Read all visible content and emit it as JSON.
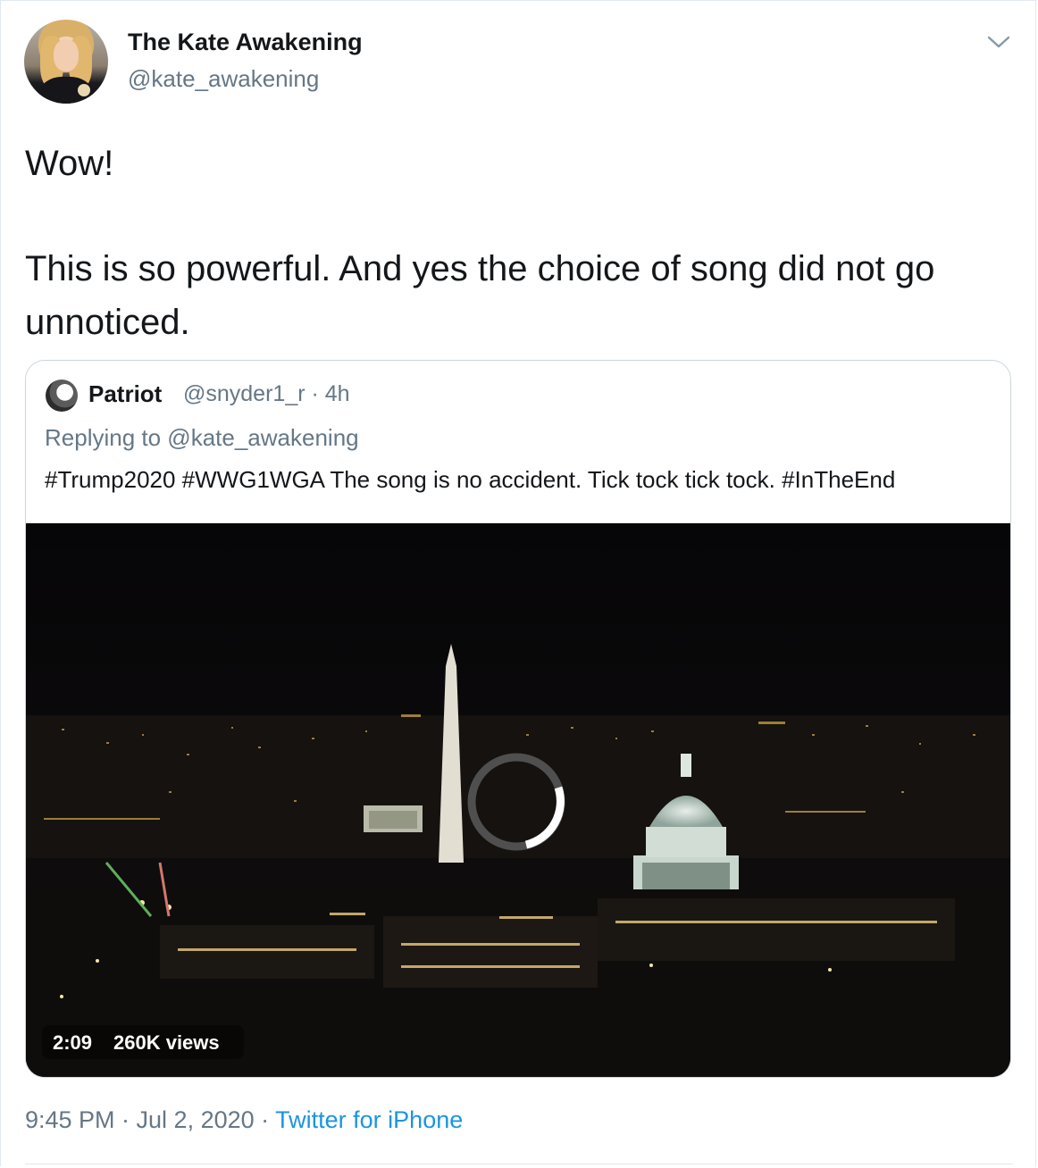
{
  "author": {
    "name": "The Kate Awakening",
    "handle": "@kate_awakening"
  },
  "tweet": {
    "line1": "Wow!",
    "line2": "This is so powerful. And yes the choice of song did not go unnoticed."
  },
  "quoted": {
    "name": "Patriot",
    "meta": "@snyder1_r · 4h",
    "replying": "Replying to @kate_awakening",
    "text": "#Trump2020 #WWG1WGA  The song is no accident. Tick tock tick tock. #InTheEnd",
    "video": {
      "duration": "2:09",
      "views": "260K views"
    }
  },
  "footer": {
    "timestamp": "9:45 PM · Jul 2, 2020 · ",
    "source": "Twitter for iPhone"
  },
  "colors": {
    "muted": "#657786",
    "link": "#1b95e0",
    "border": "#ccd6dd"
  },
  "icons": {
    "menu": "chevron-down-icon",
    "loading": "spinner-icon"
  }
}
